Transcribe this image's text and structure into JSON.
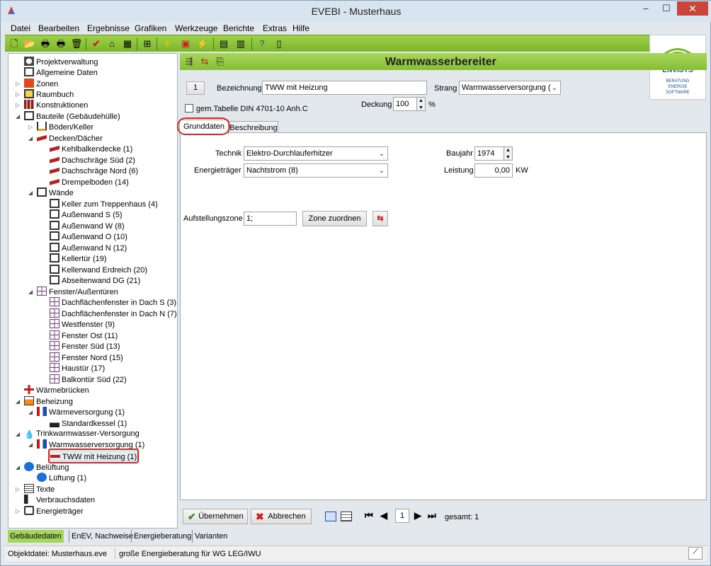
{
  "window": {
    "title": "EVEBI - Musterhaus",
    "minimize": "–",
    "maximize": "☐",
    "close": "✕"
  },
  "menu": [
    "Datei",
    "Bearbeiten",
    "Ergebnisse",
    "Grafiken",
    "Werkzeuge",
    "Berichte",
    "Extras",
    "Hilfe"
  ],
  "logo": {
    "name": "ENVISYS",
    "tagline1": "BERATUNG",
    "tagline2": "ENERGIE",
    "tagline3": "SOFTWARE"
  },
  "tree": {
    "items": [
      {
        "label": "Projektverwaltung"
      },
      {
        "label": "Allgemeine Daten"
      },
      {
        "label": "Zonen"
      },
      {
        "label": "Raumbuch"
      },
      {
        "label": "Konstruktionen"
      },
      {
        "label": "Bauteile (Gebäudehülle)"
      },
      {
        "label": "Böden/Keller"
      },
      {
        "label": "Decken/Dächer"
      },
      {
        "label": "Kehlbalkendecke (1)"
      },
      {
        "label": "Dachschräge Süd (2)"
      },
      {
        "label": "Dachschräge Nord (6)"
      },
      {
        "label": "Drempelboden (14)"
      },
      {
        "label": "Wände"
      },
      {
        "label": "Keller zum Treppenhaus (4)"
      },
      {
        "label": "Außenwand S (5)"
      },
      {
        "label": "Außenwand W (8)"
      },
      {
        "label": "Außenwand O (10)"
      },
      {
        "label": "Außenwand N (12)"
      },
      {
        "label": "Kellertür (19)"
      },
      {
        "label": "Kellerwand Erdreich (20)"
      },
      {
        "label": "Abseitenwand DG (21)"
      },
      {
        "label": "Fenster/Außentüren"
      },
      {
        "label": "Dachflächenfenster in Dach S (3)"
      },
      {
        "label": "Dachflächenfenster in Dach N (7)"
      },
      {
        "label": "Westfenster (9)"
      },
      {
        "label": "Fenster Ost (11)"
      },
      {
        "label": "Fenster Süd (13)"
      },
      {
        "label": "Fenster Nord (15)"
      },
      {
        "label": "Haustür (17)"
      },
      {
        "label": "Balkontür Süd (22)"
      },
      {
        "label": "Wärmebrücken"
      },
      {
        "label": "Beheizung"
      },
      {
        "label": "Wärmeversorgung (1)"
      },
      {
        "label": "Standardkessel (1)"
      },
      {
        "label": "Trinkwarmwasser-Versorgung"
      },
      {
        "label": "Warmwasserversorgung (1)"
      },
      {
        "label": "TWW mit Heizung (1)"
      },
      {
        "label": "Belüftung"
      },
      {
        "label": "Lüftung (1)"
      },
      {
        "label": "Texte"
      },
      {
        "label": "Verbrauchsdaten"
      },
      {
        "label": "Energieträger"
      }
    ]
  },
  "header": {
    "title": "Warmwasserbereiter"
  },
  "form": {
    "number": "1",
    "bezeichnung_label": "Bezeichnung",
    "bezeichnung_value": "TWW mit Heizung",
    "strang_label": "Strang",
    "strang_value": "Warmwasserversorgung (",
    "gem_tabelle_label": "gem.Tabelle DIN 4701-10 Anh.C",
    "deckung_label": "Deckung",
    "deckung_value": "100",
    "deckung_unit": "%"
  },
  "tabs": [
    "Grunddaten",
    "Beschreibung"
  ],
  "grunddaten": {
    "technik_label": "Technik",
    "technik_value": "Elektro-Durchlauferhitzer",
    "energietraeger_label": "Energieträger",
    "energietraeger_value": "Nachtstrom (8)",
    "baujahr_label": "Baujahr",
    "baujahr_value": "1974",
    "leistung_label": "Leistung",
    "leistung_value": "0,00",
    "leistung_unit": "KW",
    "aufstellungszone_label": "Aufstellungszone",
    "aufstellungszone_value": "1;",
    "zone_button": "Zone zuordnen"
  },
  "actions": {
    "uebernehmen": "Übernehmen",
    "abbrechen": "Abbrechen",
    "page": "1",
    "gesamt": "gesamt: 1"
  },
  "bottom_tabs": [
    "Gebäudedaten",
    "EnEV, Nachweise",
    "Energieberatung",
    "Varianten"
  ],
  "status": {
    "file": "Objektdatei: Musterhaus.eve",
    "desc": "große Energieberatung für WG LEG/IWU"
  }
}
